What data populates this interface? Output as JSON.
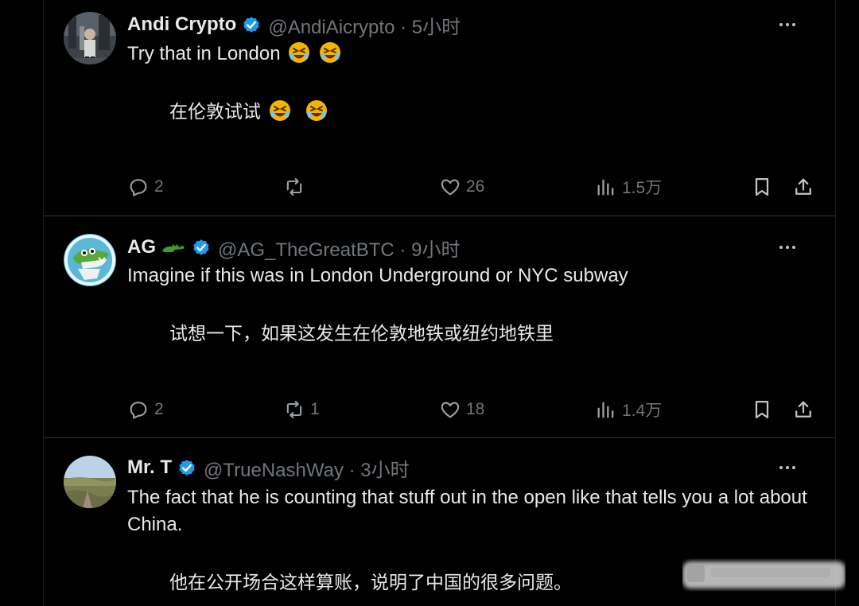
{
  "tweets": [
    {
      "name": "Andi Crypto",
      "handle": "@AndiAicrypto · 5小时",
      "text_en": "Try that in London",
      "text_zh": "在伦敦试试",
      "actions": {
        "replies": "2",
        "retweets": "",
        "likes": "26",
        "views": "1.5万"
      }
    },
    {
      "name": "AG",
      "handle": "@AG_TheGreatBTC · 9小时",
      "text_en": "Imagine if this was in London Underground or NYC subway",
      "text_zh": "试想一下，如果这发生在伦敦地铁或纽约地铁里",
      "actions": {
        "replies": "2",
        "retweets": "1",
        "likes": "18",
        "views": "1.4万"
      }
    },
    {
      "name": "Mr. T",
      "handle": "@TrueNashWay · 3小时",
      "text_en": "The fact that he is counting that stuff out in the open like that tells you a lot about China.",
      "text_zh": "他在公开场合这样算账，说明了中国的很多问题。"
    }
  ],
  "colors": {
    "background": "#000000",
    "primary_text": "#e7e9ea",
    "secondary_text": "#71767b",
    "verified_badge": "#1d9bf0",
    "divider": "#2f3336"
  },
  "icons": {
    "verified": "verified-badge-icon",
    "more": "more-options-icon",
    "reply": "reply-icon",
    "retweet": "retweet-icon",
    "like": "like-icon",
    "views": "views-icon",
    "bookmark": "bookmark-icon",
    "share": "share-icon",
    "laugh_emoji": "rolling-on-floor-laughing-emoji",
    "crocodile_emoji": "crocodile-emoji"
  }
}
